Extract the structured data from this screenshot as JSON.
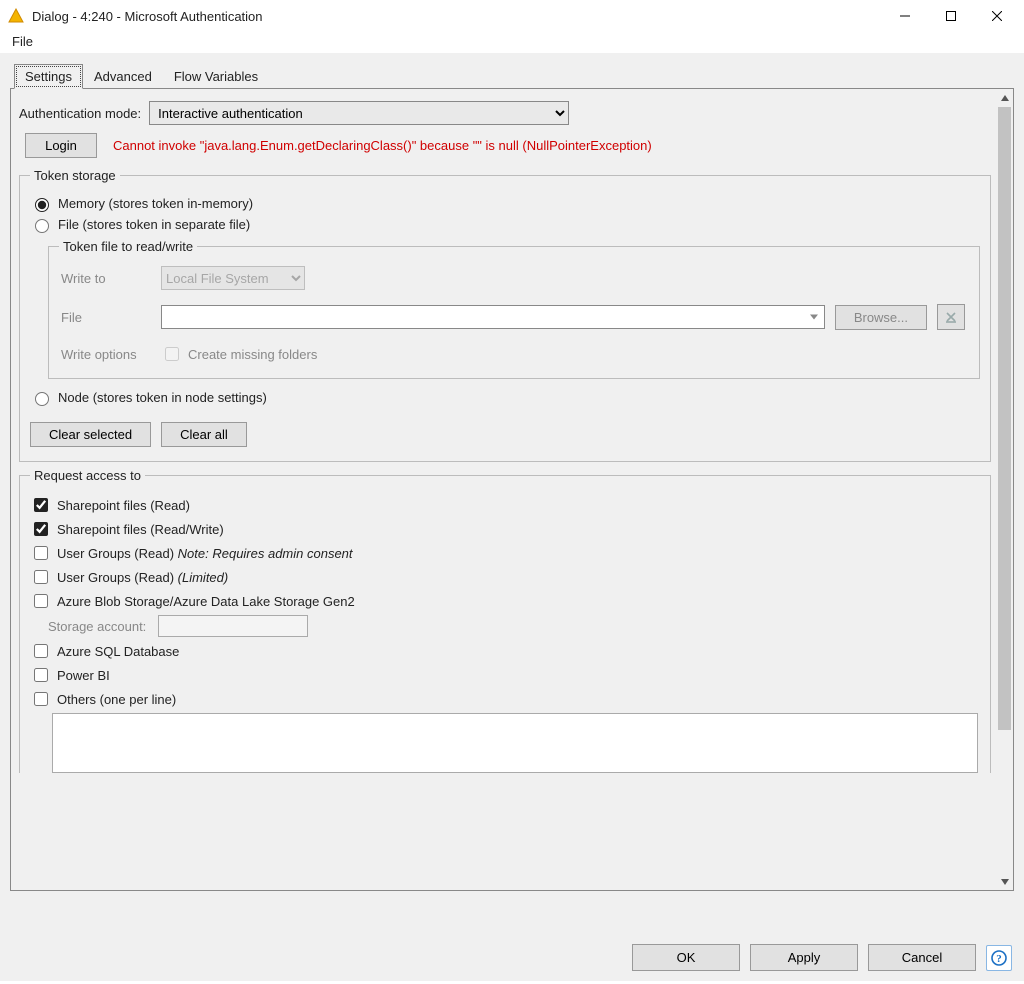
{
  "window": {
    "title": "Dialog - 4:240 - Microsoft Authentication"
  },
  "menubar": {
    "file": "File"
  },
  "tabs": {
    "settings": "Settings",
    "advanced": "Advanced",
    "flow": "Flow Variables"
  },
  "auth": {
    "mode_label": "Authentication mode:",
    "mode_value": "Interactive authentication",
    "login_button": "Login",
    "error": "Cannot invoke \"java.lang.Enum.getDeclaringClass()\" because \"\" is null (NullPointerException)"
  },
  "storage": {
    "legend": "Token storage",
    "memory": "Memory (stores token in-memory)",
    "file": "File (stores token in separate file)",
    "token_file_legend": "Token file to read/write",
    "write_to": "Write to",
    "write_to_value": "Local File System",
    "file_label": "File",
    "browse": "Browse...",
    "write_options": "Write options",
    "create_missing": "Create missing folders",
    "node": "Node (stores token in node settings)",
    "clear_selected": "Clear selected",
    "clear_all": "Clear all"
  },
  "access": {
    "legend": "Request access to",
    "sp_read": "Sharepoint files (Read)",
    "sp_rw": "Sharepoint files (Read/Write)",
    "ug_read": "User Groups (Read) ",
    "ug_read_note": "Note: Requires admin consent",
    "ug_read_lim": "User Groups (Read) ",
    "ug_read_lim_note": "(Limited)",
    "blob": "Azure Blob Storage/Azure Data Lake Storage Gen2",
    "storage_account": "Storage account:",
    "sqldb": "Azure SQL Database",
    "powerbi": "Power BI",
    "others": "Others (one per line)"
  },
  "footer": {
    "ok": "OK",
    "apply": "Apply",
    "cancel": "Cancel"
  }
}
